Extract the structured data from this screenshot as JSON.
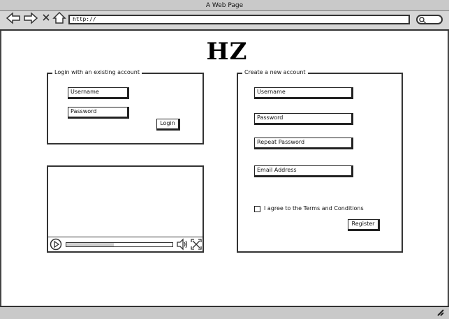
{
  "window": {
    "title": "A Web Page"
  },
  "toolbar": {
    "url": "http://",
    "icons": [
      "back-arrow-icon",
      "forward-arrow-icon",
      "close-icon",
      "home-icon",
      "search-icon"
    ]
  },
  "logo": {
    "text": "HZ"
  },
  "login": {
    "legend": "Login with an existing account",
    "username_placeholder": "Username",
    "password_placeholder": "Password",
    "button": "Login"
  },
  "register": {
    "legend": "Create a new account",
    "username_placeholder": "Username",
    "password_placeholder": "Password",
    "repeat_password_placeholder": "Repeat Password",
    "email_placeholder": "Email Address",
    "terms_label": "I agree to the Terms and Conditions",
    "terms_checked": false,
    "button": "Register"
  },
  "video": {
    "progress": 0.45,
    "icons": [
      "play-icon",
      "volume-icon",
      "fullscreen-icon"
    ]
  }
}
